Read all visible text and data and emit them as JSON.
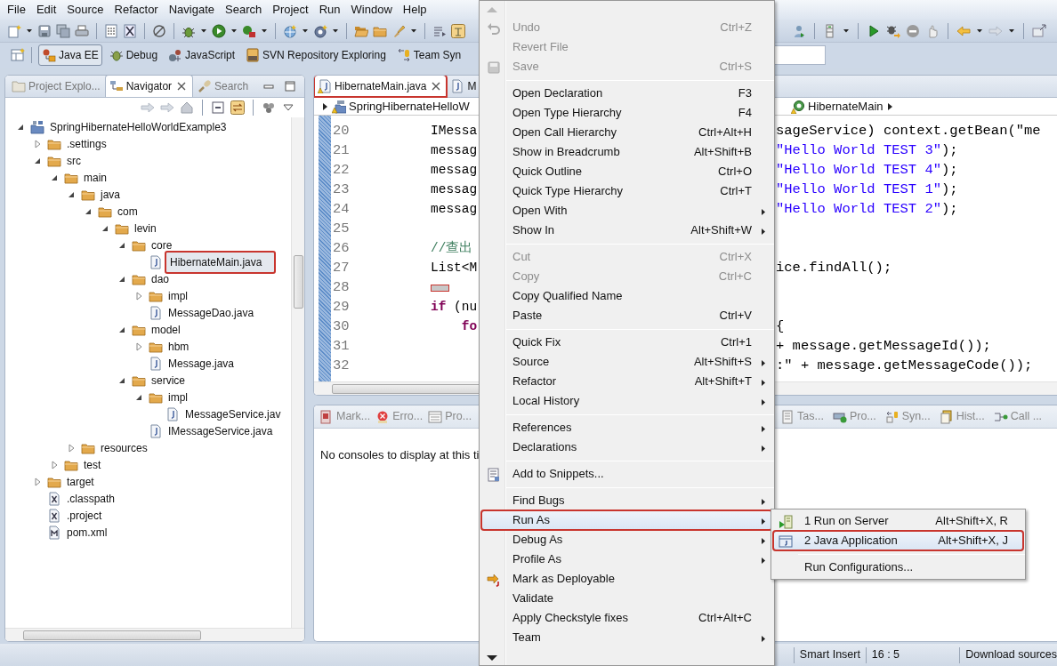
{
  "menubar": [
    "File",
    "Edit",
    "Source",
    "Refactor",
    "Navigate",
    "Search",
    "Project",
    "Run",
    "Window",
    "Help"
  ],
  "perspectives": [
    {
      "label": "Java EE",
      "selected": true
    },
    {
      "label": "Debug",
      "selected": false
    },
    {
      "label": "JavaScript",
      "selected": false
    },
    {
      "label": "SVN Repository Exploring",
      "selected": false
    },
    {
      "label": "Team Syn",
      "selected": false
    }
  ],
  "project_panel": {
    "tabs": [
      {
        "label": "Project Explo...",
        "selected": false
      },
      {
        "label": "Navigator",
        "selected": true
      },
      {
        "label": "Search",
        "selected": false
      }
    ],
    "tree": [
      {
        "label": "SpringHibernateHelloWorldExample3",
        "kind": "project",
        "expanded": true,
        "selected": false,
        "annotated": false,
        "children": [
          {
            "label": ".settings",
            "kind": "folder",
            "expanded": false,
            "selected": false,
            "annotated": false
          },
          {
            "label": "src",
            "kind": "folder",
            "expanded": true,
            "selected": false,
            "annotated": false,
            "children": [
              {
                "label": "main",
                "kind": "folder",
                "expanded": true,
                "selected": false,
                "annotated": false,
                "children": [
                  {
                    "label": "java",
                    "kind": "folder",
                    "expanded": true,
                    "selected": false,
                    "annotated": false,
                    "children": [
                      {
                        "label": "com",
                        "kind": "folder",
                        "expanded": true,
                        "selected": false,
                        "annotated": false,
                        "children": [
                          {
                            "label": "levin",
                            "kind": "folder",
                            "expanded": true,
                            "selected": false,
                            "annotated": false,
                            "children": [
                              {
                                "label": "core",
                                "kind": "folder",
                                "expanded": true,
                                "selected": false,
                                "annotated": false,
                                "children": [
                                  {
                                    "label": "HibernateMain.java",
                                    "kind": "java",
                                    "selected": true,
                                    "annotated": true
                                  }
                                ]
                              },
                              {
                                "label": "dao",
                                "kind": "folder",
                                "expanded": true,
                                "selected": false,
                                "annotated": false,
                                "children": [
                                  {
                                    "label": "impl",
                                    "kind": "folder",
                                    "expanded": false,
                                    "selected": false,
                                    "annotated": false
                                  },
                                  {
                                    "label": "MessageDao.java",
                                    "kind": "java",
                                    "selected": false,
                                    "annotated": false
                                  }
                                ]
                              },
                              {
                                "label": "model",
                                "kind": "folder",
                                "expanded": true,
                                "selected": false,
                                "annotated": false,
                                "children": [
                                  {
                                    "label": "hbm",
                                    "kind": "folder",
                                    "expanded": false,
                                    "selected": false,
                                    "annotated": false
                                  },
                                  {
                                    "label": "Message.java",
                                    "kind": "java",
                                    "selected": false,
                                    "annotated": false
                                  }
                                ]
                              },
                              {
                                "label": "service",
                                "kind": "folder",
                                "expanded": true,
                                "selected": false,
                                "annotated": false,
                                "children": [
                                  {
                                    "label": "impl",
                                    "kind": "folder",
                                    "expanded": true,
                                    "selected": false,
                                    "annotated": false,
                                    "children": [
                                      {
                                        "label": "MessageService.jav",
                                        "kind": "java",
                                        "selected": false,
                                        "annotated": false
                                      }
                                    ]
                                  },
                                  {
                                    "label": "IMessageService.java",
                                    "kind": "java",
                                    "selected": false,
                                    "annotated": false
                                  }
                                ]
                              }
                            ]
                          }
                        ]
                      }
                    ]
                  },
                  {
                    "label": "resources",
                    "kind": "folder",
                    "expanded": false,
                    "selected": false,
                    "annotated": false
                  }
                ]
              },
              {
                "label": "test",
                "kind": "folder",
                "expanded": false,
                "selected": false,
                "annotated": false
              }
            ]
          },
          {
            "label": "target",
            "kind": "folder",
            "expanded": false,
            "selected": false,
            "annotated": false
          },
          {
            "label": ".classpath",
            "kind": "xml",
            "selected": false,
            "annotated": false
          },
          {
            "label": ".project",
            "kind": "xml",
            "selected": false,
            "annotated": false
          },
          {
            "label": "pom.xml",
            "kind": "maven",
            "selected": false,
            "annotated": false
          }
        ]
      }
    ]
  },
  "editor": {
    "tabs": [
      {
        "label": "HibernateMain.java",
        "selected": true,
        "annotated": true
      },
      {
        "label": "M",
        "selected": false,
        "annotated": false
      }
    ],
    "breadcrumb_left": "SpringHibernateHelloW",
    "breadcrumb_right": "HibernateMain",
    "lines": [
      {
        "number": "20",
        "left": [
          {
            "text": "IMessa",
            "kind": "plain"
          }
        ],
        "right": [
          {
            "text": "sageService) context.getBean(\"me",
            "kind": "plain"
          }
        ]
      },
      {
        "number": "21",
        "left": [
          {
            "text": "messag",
            "kind": "plain"
          }
        ],
        "right": [
          {
            "text": "\"Hello World TEST 3\"",
            "kind": "string"
          },
          {
            "text": ");",
            "kind": "plain"
          }
        ]
      },
      {
        "number": "22",
        "left": [
          {
            "text": "messag",
            "kind": "plain"
          }
        ],
        "right": [
          {
            "text": "\"Hello World TEST 4\"",
            "kind": "string"
          },
          {
            "text": ");",
            "kind": "plain"
          }
        ]
      },
      {
        "number": "23",
        "left": [
          {
            "text": "messag",
            "kind": "plain"
          }
        ],
        "right": [
          {
            "text": "\"Hello World TEST 1\"",
            "kind": "string"
          },
          {
            "text": ");",
            "kind": "plain"
          }
        ]
      },
      {
        "number": "24",
        "left": [
          {
            "text": "messag",
            "kind": "plain"
          }
        ],
        "right": [
          {
            "text": "\"Hello World TEST 2\"",
            "kind": "string"
          },
          {
            "text": ");",
            "kind": "plain"
          }
        ]
      },
      {
        "number": "25"
      },
      {
        "number": "26",
        "left": [
          {
            "text": "//查出",
            "kind": "comment"
          }
        ]
      },
      {
        "number": "27",
        "left": [
          {
            "text": "List<M",
            "kind": "plain"
          }
        ],
        "right": [
          {
            "text": "ice.findAll();",
            "kind": "plain"
          }
        ]
      },
      {
        "number": "28",
        "marker": true
      },
      {
        "number": "29",
        "left": [
          {
            "text": "if",
            "kind": "keyword"
          },
          {
            "text": " (nu",
            "kind": "plain"
          }
        ]
      },
      {
        "number": "30",
        "left": [
          {
            "text": "    fo",
            "kind": "keyword"
          }
        ],
        "right": [
          {
            "text": "{",
            "kind": "plain"
          }
        ]
      },
      {
        "number": "31",
        "right": [
          {
            "text": "+ message.getMessageId());",
            "kind": "plain"
          }
        ]
      },
      {
        "number": "32",
        "right": [
          {
            "text": ":\" + message.getMessageCode());",
            "kind": "plain"
          }
        ]
      }
    ]
  },
  "bottom_panel": {
    "tabs_left": [
      "Mark...",
      "Erro...",
      "Pro..."
    ],
    "tabs_right": [
      "Tas...",
      "Pro...",
      "Syn...",
      "Hist...",
      "Call ..."
    ],
    "message": "No consoles to display at this ti"
  },
  "context_menu": {
    "items": [
      {
        "kind": "item",
        "label": "Undo",
        "shortcut": "Ctrl+Z",
        "disabled": true,
        "submenu": false,
        "selected": false,
        "annotated": false
      },
      {
        "kind": "item",
        "label": "Revert File",
        "disabled": true,
        "submenu": false,
        "selected": false,
        "annotated": false
      },
      {
        "kind": "item",
        "label": "Save",
        "shortcut": "Ctrl+S",
        "disabled": true,
        "submenu": false,
        "selected": false,
        "annotated": false
      },
      {
        "kind": "separator"
      },
      {
        "kind": "item",
        "label": "Open Declaration",
        "shortcut": "F3",
        "disabled": false,
        "submenu": false,
        "selected": false,
        "annotated": false
      },
      {
        "kind": "item",
        "label": "Open Type Hierarchy",
        "shortcut": "F4",
        "disabled": false,
        "submenu": false,
        "selected": false,
        "annotated": false
      },
      {
        "kind": "item",
        "label": "Open Call Hierarchy",
        "shortcut": "Ctrl+Alt+H",
        "disabled": false,
        "submenu": false,
        "selected": false,
        "annotated": false
      },
      {
        "kind": "item",
        "label": "Show in Breadcrumb",
        "shortcut": "Alt+Shift+B",
        "disabled": false,
        "submenu": false,
        "selected": false,
        "annotated": false
      },
      {
        "kind": "item",
        "label": "Quick Outline",
        "shortcut": "Ctrl+O",
        "disabled": false,
        "submenu": false,
        "selected": false,
        "annotated": false
      },
      {
        "kind": "item",
        "label": "Quick Type Hierarchy",
        "shortcut": "Ctrl+T",
        "disabled": false,
        "submenu": false,
        "selected": false,
        "annotated": false
      },
      {
        "kind": "item",
        "label": "Open With",
        "disabled": false,
        "submenu": true,
        "selected": false,
        "annotated": false
      },
      {
        "kind": "item",
        "label": "Show In",
        "shortcut": "Alt+Shift+W",
        "disabled": false,
        "submenu": true,
        "selected": false,
        "annotated": false
      },
      {
        "kind": "separator"
      },
      {
        "kind": "item",
        "label": "Cut",
        "shortcut": "Ctrl+X",
        "disabled": true,
        "submenu": false,
        "selected": false,
        "annotated": false
      },
      {
        "kind": "item",
        "label": "Copy",
        "shortcut": "Ctrl+C",
        "disabled": true,
        "submenu": false,
        "selected": false,
        "annotated": false
      },
      {
        "kind": "item",
        "label": "Copy Qualified Name",
        "disabled": false,
        "submenu": false,
        "selected": false,
        "annotated": false
      },
      {
        "kind": "item",
        "label": "Paste",
        "shortcut": "Ctrl+V",
        "disabled": false,
        "submenu": false,
        "selected": false,
        "annotated": false
      },
      {
        "kind": "separator"
      },
      {
        "kind": "item",
        "label": "Quick Fix",
        "shortcut": "Ctrl+1",
        "disabled": false,
        "submenu": false,
        "selected": false,
        "annotated": false
      },
      {
        "kind": "item",
        "label": "Source",
        "shortcut": "Alt+Shift+S",
        "disabled": false,
        "submenu": true,
        "selected": false,
        "annotated": false
      },
      {
        "kind": "item",
        "label": "Refactor",
        "shortcut": "Alt+Shift+T",
        "disabled": false,
        "submenu": true,
        "selected": false,
        "annotated": false
      },
      {
        "kind": "item",
        "label": "Local History",
        "disabled": false,
        "submenu": true,
        "selected": false,
        "annotated": false
      },
      {
        "kind": "separator"
      },
      {
        "kind": "item",
        "label": "References",
        "disabled": false,
        "submenu": true,
        "selected": false,
        "annotated": false
      },
      {
        "kind": "item",
        "label": "Declarations",
        "disabled": false,
        "submenu": true,
        "selected": false,
        "annotated": false
      },
      {
        "kind": "separator"
      },
      {
        "kind": "item",
        "label": "Add to Snippets...",
        "disabled": false,
        "submenu": false,
        "selected": false,
        "annotated": false
      },
      {
        "kind": "separator"
      },
      {
        "kind": "item",
        "label": "Find Bugs",
        "disabled": false,
        "submenu": true,
        "selected": false,
        "annotated": false
      },
      {
        "kind": "item",
        "label": "Run As",
        "disabled": false,
        "submenu": true,
        "selected": true,
        "annotated": true
      },
      {
        "kind": "item",
        "label": "Debug As",
        "disabled": false,
        "submenu": true,
        "selected": false,
        "annotated": false
      },
      {
        "kind": "item",
        "label": "Profile As",
        "disabled": false,
        "submenu": true,
        "selected": false,
        "annotated": false
      },
      {
        "kind": "item",
        "label": "Mark as Deployable",
        "disabled": false,
        "submenu": false,
        "selected": false,
        "annotated": false
      },
      {
        "kind": "item",
        "label": "Validate",
        "disabled": false,
        "submenu": false,
        "selected": false,
        "annotated": false
      },
      {
        "kind": "item",
        "label": "Apply Checkstyle fixes",
        "shortcut": "Ctrl+Alt+C",
        "disabled": false,
        "submenu": false,
        "selected": false,
        "annotated": false
      },
      {
        "kind": "item",
        "label": "Team",
        "disabled": false,
        "submenu": true,
        "selected": false,
        "annotated": false
      }
    ]
  },
  "submenu": {
    "items": [
      {
        "kind": "item",
        "label": "1 Run on Server",
        "shortcut": "Alt+Shift+X, R",
        "selected": false,
        "annotated": false
      },
      {
        "kind": "item",
        "label": "2 Java Application",
        "shortcut": "Alt+Shift+X, J",
        "selected": true,
        "annotated": true
      },
      {
        "kind": "separator"
      },
      {
        "kind": "item",
        "label": "Run Configurations...",
        "selected": false,
        "annotated": false
      }
    ]
  },
  "status_bar": [
    "Smart Insert",
    "16 : 5",
    "Download sources"
  ]
}
